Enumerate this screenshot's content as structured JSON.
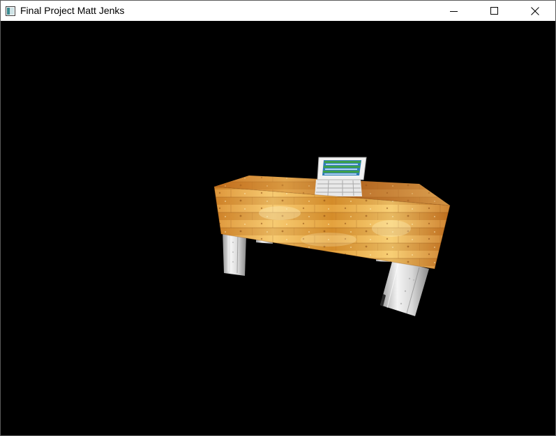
{
  "window": {
    "title": "Final Project Matt Jenks",
    "background": "#000000",
    "controls": {
      "minimize_icon": "minimize-icon",
      "maximize_icon": "maximize-icon",
      "close_icon": "close-icon"
    }
  },
  "scene": {
    "objects": [
      "desk",
      "laptop"
    ],
    "desk_texture": "wood",
    "leg_texture": "metal",
    "colors": {
      "wood_light": "#f6c66a",
      "wood_mid": "#d98a2a",
      "wood_dark": "#8a4a12",
      "metal_light": "#f4f4f4",
      "metal_dark": "#9a9a9a",
      "screen_blue": "#2f7db7",
      "screen_green": "#3da04a"
    }
  }
}
